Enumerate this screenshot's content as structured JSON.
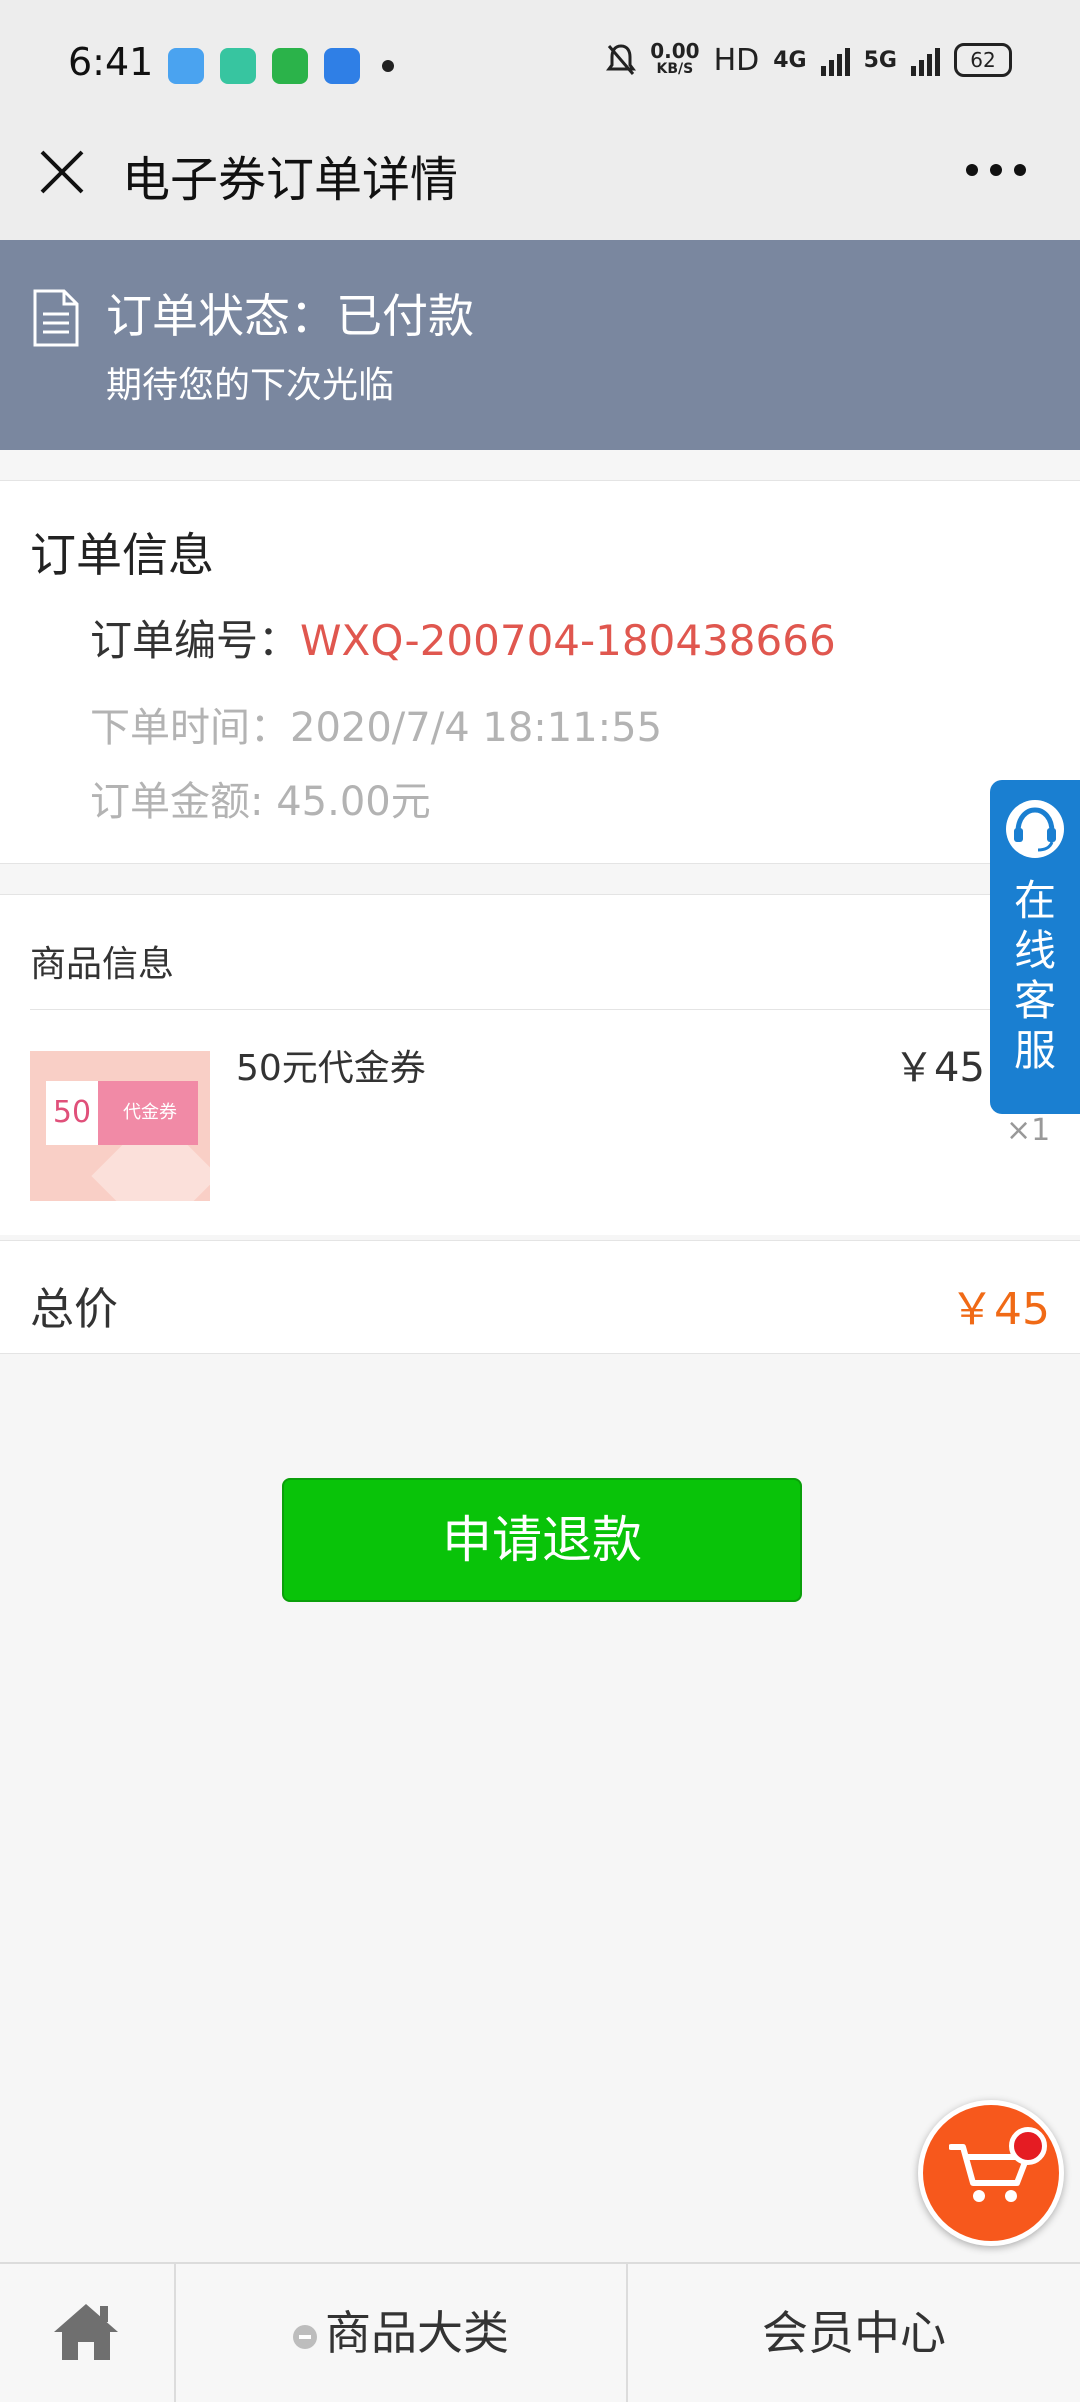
{
  "status_bar": {
    "time": "6:41",
    "net_speed_value": "0.00",
    "net_speed_unit": "KB/S",
    "hd": "HD",
    "signal1": "4G",
    "signal2": "5G",
    "battery": "62"
  },
  "header": {
    "title": "电子券订单详情"
  },
  "banner": {
    "status_label": "订单状态：",
    "status_value": "已付款",
    "subtitle": "期待您的下次光临"
  },
  "order_info": {
    "title": "订单信息",
    "number_label": "订单编号：",
    "number_value": "WXQ-200704-180438666",
    "time_label": "下单时间：",
    "time_value": "2020/7/4 18:11:55",
    "amount_label": "订单金额: ",
    "amount_value": "45.00元"
  },
  "product_info": {
    "title": "商品信息",
    "items": [
      {
        "name": "50元代金券",
        "price": "￥45",
        "quantity": "×1",
        "thumb_value": "50",
        "thumb_label": "代金券"
      }
    ]
  },
  "total": {
    "label": "总价",
    "value": "￥45"
  },
  "refund_button": "申请退款",
  "service_tab": {
    "chars": [
      "在",
      "线",
      "客",
      "服"
    ]
  },
  "bottom_nav": {
    "category": "商品大类",
    "member": "会员中心"
  },
  "colors": {
    "banner_bg": "#7a879f",
    "order_number": "#e0574f",
    "total_value": "#f06a16",
    "refund_button": "#09c309",
    "service_tab": "#1a7fd1",
    "cart_button": "#f7581c"
  }
}
